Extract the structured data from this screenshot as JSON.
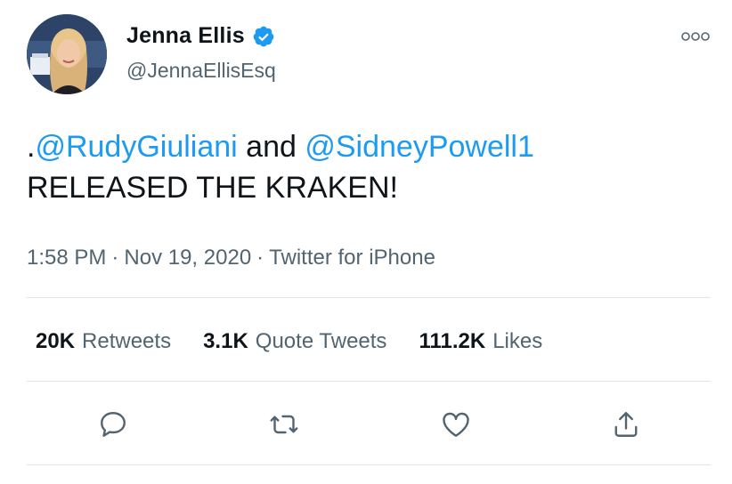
{
  "author": {
    "name": "Jenna Ellis",
    "handle": "@JennaEllisEsq"
  },
  "tweet": {
    "prefix": ".",
    "mention1": "@RudyGiuliani",
    "connector": " and ",
    "mention2": "@SidneyPowell1",
    "line2": "RELEASED THE KRAKEN!"
  },
  "meta": {
    "time": "1:58 PM",
    "date": "Nov 19, 2020",
    "source": "Twitter for iPhone",
    "separator": "·"
  },
  "stats": {
    "retweets_count": "20K",
    "retweets_label": "Retweets",
    "quotes_count": "3.1K",
    "quotes_label": "Quote Tweets",
    "likes_count": "111.2K",
    "likes_label": "Likes"
  },
  "icons": {
    "verified": "verified-badge-icon",
    "more": "more-options-icon",
    "reply": "reply-icon",
    "retweet": "retweet-icon",
    "like": "like-icon",
    "share": "share-icon"
  },
  "colors": {
    "accent": "#1d9bf0",
    "text": "#0f1419",
    "secondary": "#536471"
  }
}
